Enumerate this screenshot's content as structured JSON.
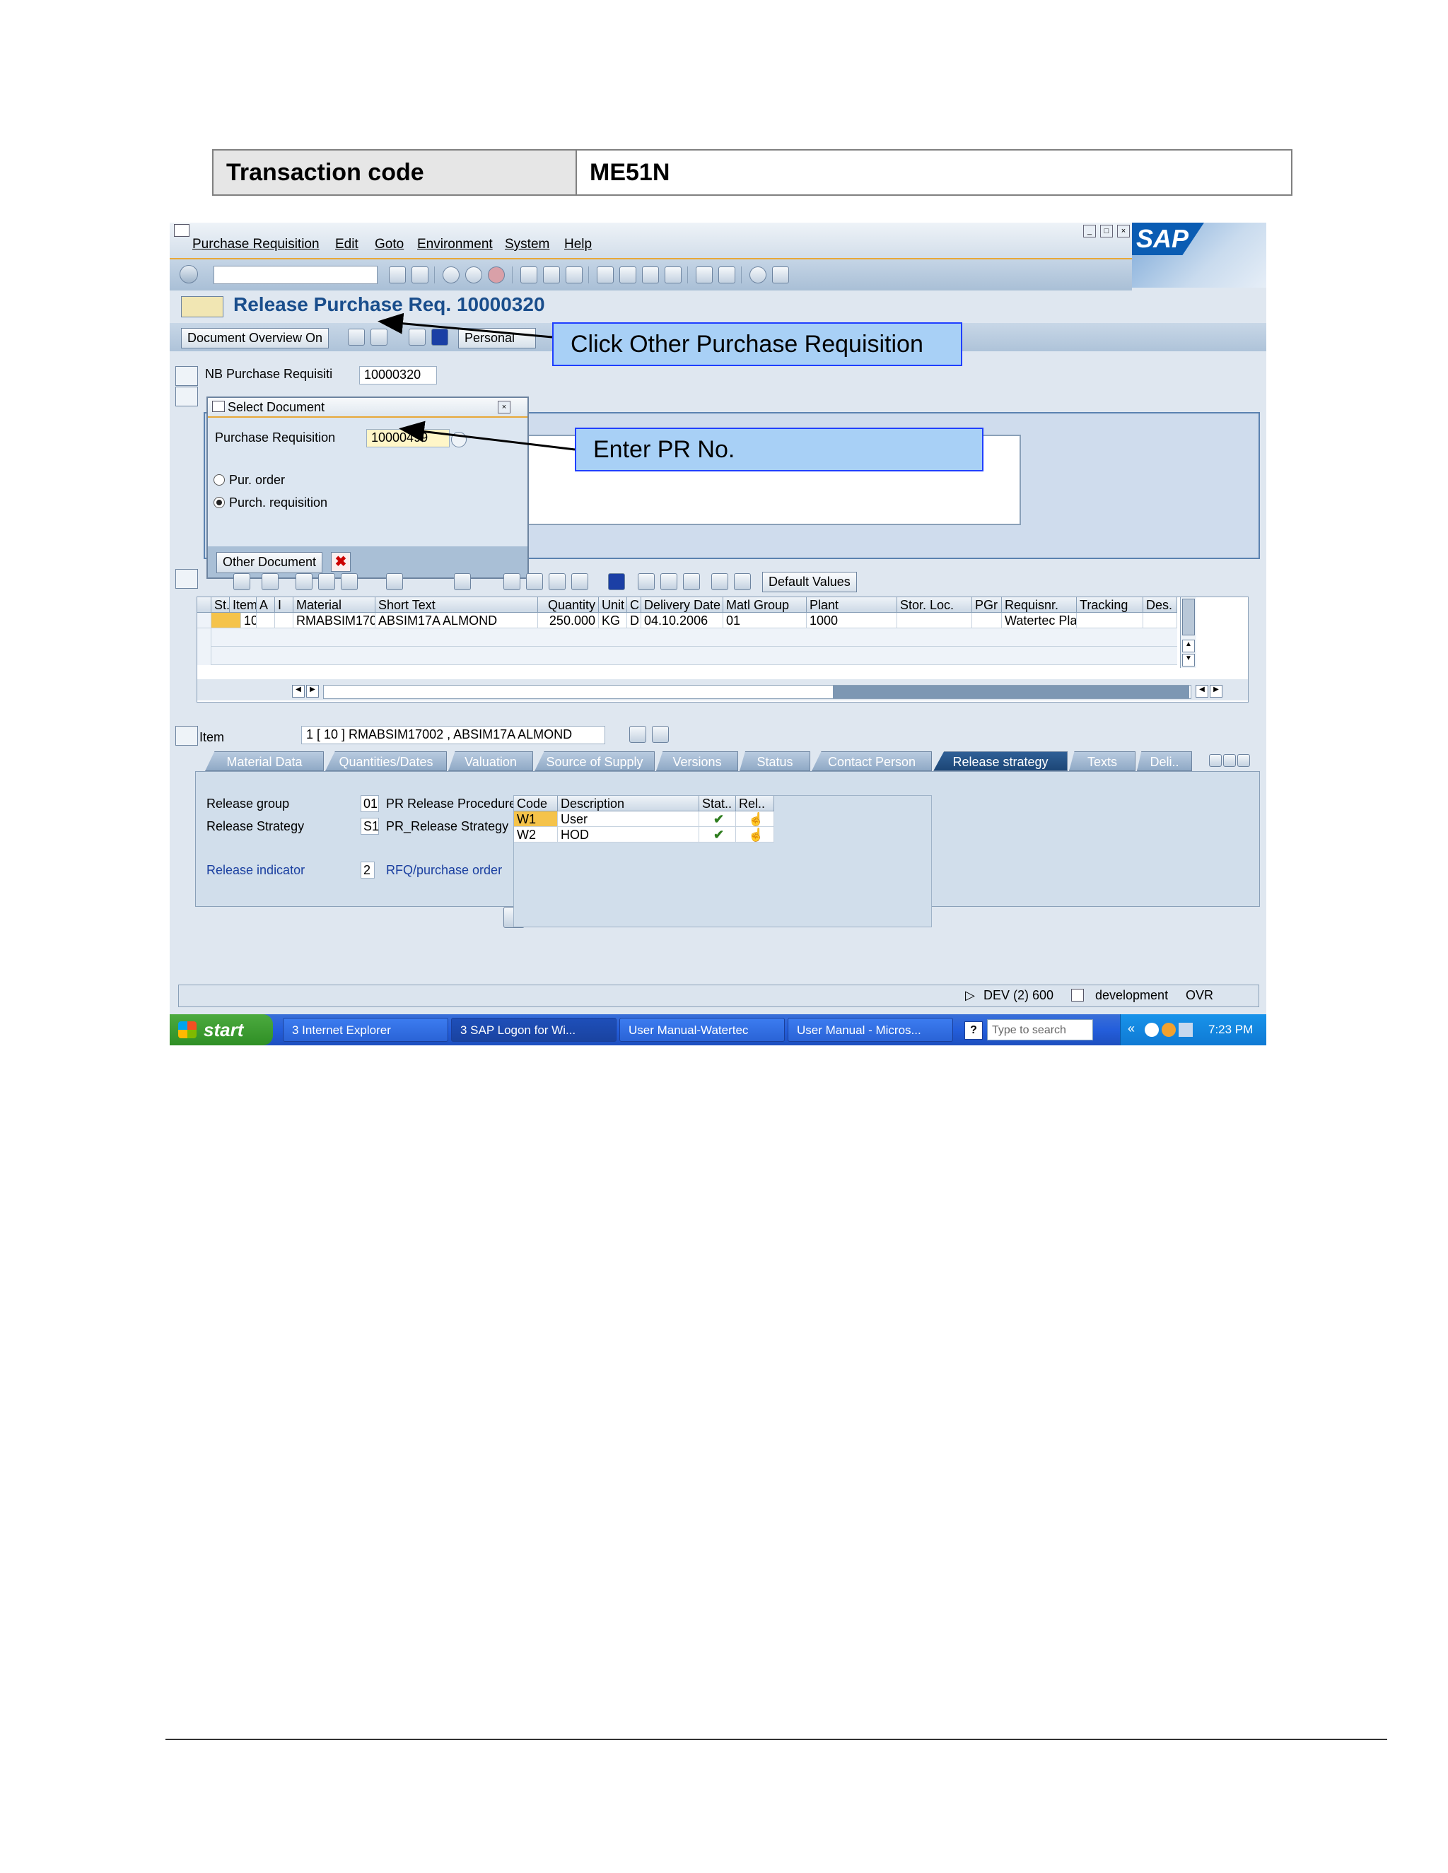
{
  "transaction": {
    "label": "Transaction code",
    "value": "ME51N"
  },
  "sap": {
    "menu": [
      "Purchase Requisition",
      "Edit",
      "Goto",
      "Environment",
      "System",
      "Help"
    ],
    "logo_text": "SAP",
    "title": "Release Purchase Req. 10000320",
    "appbar": {
      "doc_overview": "Document Overview On",
      "personal": "Personal"
    },
    "pr_type": "NB Purchase Requisiti",
    "pr_number": "10000320",
    "dialog": {
      "title": "Select Document",
      "pr_label": "Purchase Requisition",
      "pr_value": "10000499",
      "radio_po": "Pur. order",
      "radio_pr": "Purch. requisition",
      "other_doc_button": "Other Document"
    },
    "grid_toolbar": {
      "default_values": "Default Values"
    },
    "grid": {
      "headers": [
        "St..",
        "Item",
        "A",
        "I",
        "Material",
        "Short Text",
        "Quantity",
        "Unit",
        "C",
        "Delivery Date",
        "Matl Group",
        "Plant",
        "Stor. Loc.",
        "PGr",
        "Requisnr.",
        "Tracking",
        "Des."
      ],
      "row": [
        "",
        "10",
        "",
        "",
        "RMABSIM170",
        "ABSIM17A ALMOND",
        "250.000",
        "KG",
        "D",
        "04.10.2006",
        "01",
        "1000",
        "",
        "",
        "Watertec Pla",
        "",
        ""
      ]
    },
    "item": {
      "label": "Item",
      "value": "1 [ 10 ] RMABSIM17002 , ABSIM17A ALMOND"
    },
    "tabs": [
      "Material Data",
      "Quantities/Dates",
      "Valuation",
      "Source of Supply",
      "Versions",
      "Status",
      "Contact Person",
      "Release strategy",
      "Texts",
      "Deli.."
    ],
    "release": {
      "group_label": "Release group",
      "group_code": "01",
      "group_text": "PR Release Procedure",
      "strategy_label": "Release Strategy",
      "strategy_code": "S1",
      "strategy_text": "PR_Release Strategy",
      "indicator_label": "Release indicator",
      "indicator_code": "2",
      "indicator_text": "RFQ/purchase order",
      "table_headers": [
        "Code",
        "Description",
        "Stat..",
        "Rel.."
      ],
      "rows": [
        {
          "code": "W1",
          "desc": "User"
        },
        {
          "code": "W2",
          "desc": "HOD"
        }
      ]
    },
    "status": {
      "system": "DEV (2) 600",
      "server": "development",
      "mode": "OVR"
    },
    "taskbar": {
      "start": "start",
      "tasks": [
        "3 Internet Explorer",
        "3 SAP Logon for Wi...",
        "User Manual-Watertec",
        "User Manual - Micros..."
      ],
      "search_placeholder": "Type to search",
      "time": "7:23 PM"
    }
  },
  "callouts": {
    "other_pr": "Click Other Purchase Requisition",
    "enter_pr": "Enter PR No."
  },
  "colors": {
    "accent": "#e8a838",
    "sap_blue": "#1a4e8c",
    "callout_fill": "#a8d0f6",
    "callout_border": "#1f3fff"
  }
}
